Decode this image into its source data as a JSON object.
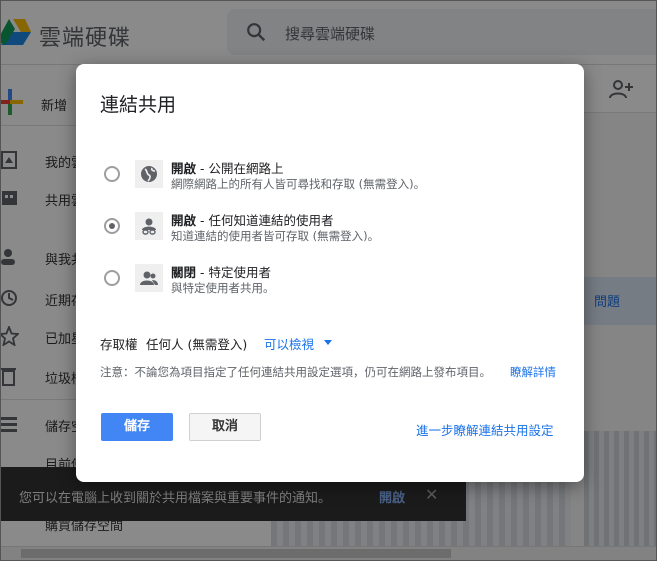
{
  "app": {
    "title": "雲端硬碟",
    "search_placeholder": "搜尋雲端硬碟"
  },
  "sidebar": {
    "new_label": "新增",
    "items": [
      {
        "label": "我的雲",
        "icon": "drive-icon"
      },
      {
        "label": "共用雲",
        "icon": "shared-drive-icon"
      },
      {
        "label": "與我共",
        "icon": "people-icon"
      },
      {
        "label": "近期存",
        "icon": "clock-icon"
      },
      {
        "label": "已加星",
        "icon": "star-icon"
      },
      {
        "label": "垃圾桶",
        "icon": "trash-icon"
      },
      {
        "label": "儲存空",
        "icon": "storage-icon"
      }
    ],
    "storage_text": "目前使",
    "buy_storage": "購買儲存空間"
  },
  "right_panel": {
    "tab_label": "問題"
  },
  "toast": {
    "message": "您可以在電腦上收到關於共用檔案與重要事件的通知。",
    "action": "開啟",
    "close": "✕"
  },
  "dialog": {
    "title": "連結共用",
    "options": [
      {
        "state": "開啟",
        "title_suffix": " - 公開在網路上",
        "description": "網際網路上的所有人皆可尋找和存取 (無需登入)。",
        "icon": "globe-icon",
        "checked": false
      },
      {
        "state": "開啟",
        "title_suffix": " - 任何知道連結的使用者",
        "description": "知道連結的使用者皆可存取 (無需登入)。",
        "icon": "link-user-icon",
        "checked": true
      },
      {
        "state": "關閉",
        "title_suffix": " - 特定使用者",
        "description": "與特定使用者共用。",
        "icon": "people-icon",
        "checked": false
      }
    ],
    "access_label": "存取權",
    "access_value": "任何人 (無需登入)",
    "access_dropdown": "可以檢視",
    "note": "注意：不論您為項目指定了任何連結共用設定選項，仍可在網路上發布項目。",
    "note_link": "瞭解詳情",
    "save_label": "儲存",
    "cancel_label": "取消",
    "learn_more": "進一步瞭解連結共用設定"
  },
  "colors": {
    "accent": "#4285f4",
    "link": "#1a73e8",
    "annotation_arrow": "#e53935"
  }
}
